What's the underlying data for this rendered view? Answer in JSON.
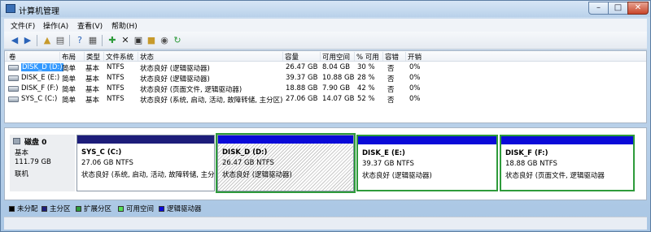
{
  "window": {
    "title": "计算机管理",
    "min": "–",
    "max": "□",
    "close": "✕"
  },
  "menu": [
    "文件(F)",
    "操作(A)",
    "查看(V)",
    "帮助(H)"
  ],
  "toolbar_icons": [
    "back-icon",
    "forward-icon",
    "up-folder-icon",
    "properties-icon",
    "help-icon",
    "new-icon",
    "delete-icon",
    "open-icon",
    "folder-icon",
    "search-icon",
    "refresh-icon"
  ],
  "columns": [
    "卷",
    "布局",
    "类型",
    "文件系统",
    "状态",
    "容量",
    "可用空间",
    "% 可用",
    "容错",
    "开销"
  ],
  "volumes": [
    {
      "name": "DISK_D (D:)",
      "layout": "简单",
      "type": "基本",
      "fs": "NTFS",
      "status": "状态良好 (逻辑驱动器)",
      "capacity": "26.47 GB",
      "free": "8.04 GB",
      "pct": "30 %",
      "fault": "否",
      "overhead": "0%"
    },
    {
      "name": "DISK_E (E:)",
      "layout": "简单",
      "type": "基本",
      "fs": "NTFS",
      "status": "状态良好 (逻辑驱动器)",
      "capacity": "39.37 GB",
      "free": "10.88 GB",
      "pct": "28 %",
      "fault": "否",
      "overhead": "0%"
    },
    {
      "name": "DISK_F (F:)",
      "layout": "简单",
      "type": "基本",
      "fs": "NTFS",
      "status": "状态良好 (页面文件, 逻辑驱动器)",
      "capacity": "18.88 GB",
      "free": "7.90 GB",
      "pct": "42 %",
      "fault": "否",
      "overhead": "0%"
    },
    {
      "name": "SYS_C (C:)",
      "layout": "简单",
      "type": "基本",
      "fs": "NTFS",
      "status": "状态良好 (系统, 启动, 活动, 故障转储, 主分区)",
      "capacity": "27.06 GB",
      "free": "14.07 GB",
      "pct": "52 %",
      "fault": "否",
      "overhead": "0%"
    }
  ],
  "disk": {
    "title": "磁盘 0",
    "type": "基本",
    "size": "111.79 GB",
    "state": "联机"
  },
  "partitions": [
    {
      "name": "SYS_C  (C:)",
      "size": "27.06 GB NTFS",
      "status": "状态良好 (系统, 启动, 活动, 故障转储, 主分",
      "bar_color": "#1d1d7a"
    },
    {
      "name": "DISK_D  (D:)",
      "size": "26.47 GB NTFS",
      "status": "状态良好 (逻辑驱动器)",
      "bar_color": "#0a0ad8"
    },
    {
      "name": "DISK_E  (E:)",
      "size": "39.37 GB NTFS",
      "status": "状态良好 (逻辑驱动器)",
      "bar_color": "#0a0ad8"
    },
    {
      "name": "DISK_F  (F:)",
      "size": "18.88 GB NTFS",
      "status": "状态良好 (页面文件, 逻辑驱动器",
      "bar_color": "#0a0ad8"
    }
  ],
  "legend": [
    {
      "label": "未分配",
      "color": "#000000"
    },
    {
      "label": "主分区",
      "color": "#1d1d7a"
    },
    {
      "label": "扩展分区",
      "color": "#2e9b3b"
    },
    {
      "label": "可用空间",
      "color": "#58e058"
    },
    {
      "label": "逻辑驱动器",
      "color": "#0a0ad8"
    }
  ],
  "colors": {
    "selection": "#3399ff",
    "active_outline": "#2e9b3b"
  }
}
